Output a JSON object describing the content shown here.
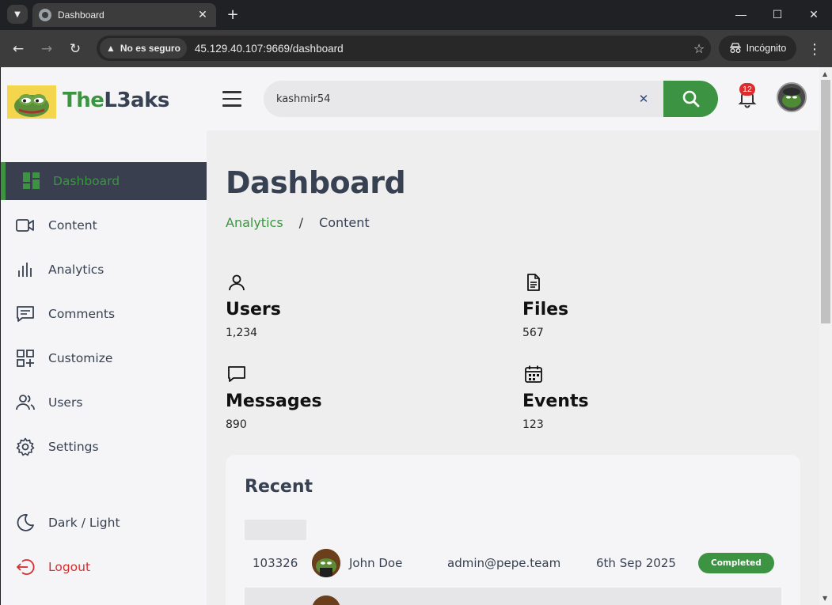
{
  "browser": {
    "tab_title": "Dashboard",
    "security_label": "No es seguro",
    "url": "45.129.40.107:9669/dashboard",
    "incognito_label": "Incógnito",
    "icons": [
      "tab-search-icon",
      "close-icon",
      "plus-icon",
      "minimize-icon",
      "maximize-icon",
      "close-window-icon",
      "back-icon",
      "forward-icon",
      "reload-icon",
      "warning-icon",
      "star-icon",
      "incognito-icon",
      "more-vert-icon"
    ]
  },
  "header": {
    "brand_prefix": "The",
    "brand_suffix": "L3aks",
    "search_value": "kashmir54",
    "notification_count": "12"
  },
  "sidebar": {
    "items": [
      {
        "label": "Dashboard",
        "icon": "dashboard-icon",
        "active": true
      },
      {
        "label": "Content",
        "icon": "video-icon"
      },
      {
        "label": "Analytics",
        "icon": "bar-chart-icon"
      },
      {
        "label": "Comments",
        "icon": "comment-icon"
      },
      {
        "label": "Customize",
        "icon": "grid-plus-icon"
      },
      {
        "label": "Users",
        "icon": "users-icon"
      },
      {
        "label": "Settings",
        "icon": "gear-icon"
      }
    ],
    "theme_toggle": "Dark / Light",
    "logout": "Logout"
  },
  "main": {
    "title": "Dashboard",
    "breadcrumb": {
      "link": "Analytics",
      "separator": "/",
      "current": "Content"
    },
    "stats": [
      {
        "title": "Users",
        "value": "1,234",
        "icon": "user-icon"
      },
      {
        "title": "Files",
        "value": "567",
        "icon": "file-icon"
      },
      {
        "title": "Messages",
        "value": "890",
        "icon": "message-icon"
      },
      {
        "title": "Events",
        "value": "123",
        "icon": "calendar-icon"
      }
    ],
    "recent": {
      "title": "Recent",
      "rows": [
        {
          "id": "103326",
          "name": "John Doe",
          "email": "admin@pepe.team",
          "date": "6th Sep 2025",
          "status": "Completed"
        }
      ]
    }
  },
  "colors": {
    "accent_green": "#3c9443",
    "active_bg": "#3a3f50",
    "logout_red": "#d32f2f",
    "badge_red": "#dd2c2c"
  }
}
